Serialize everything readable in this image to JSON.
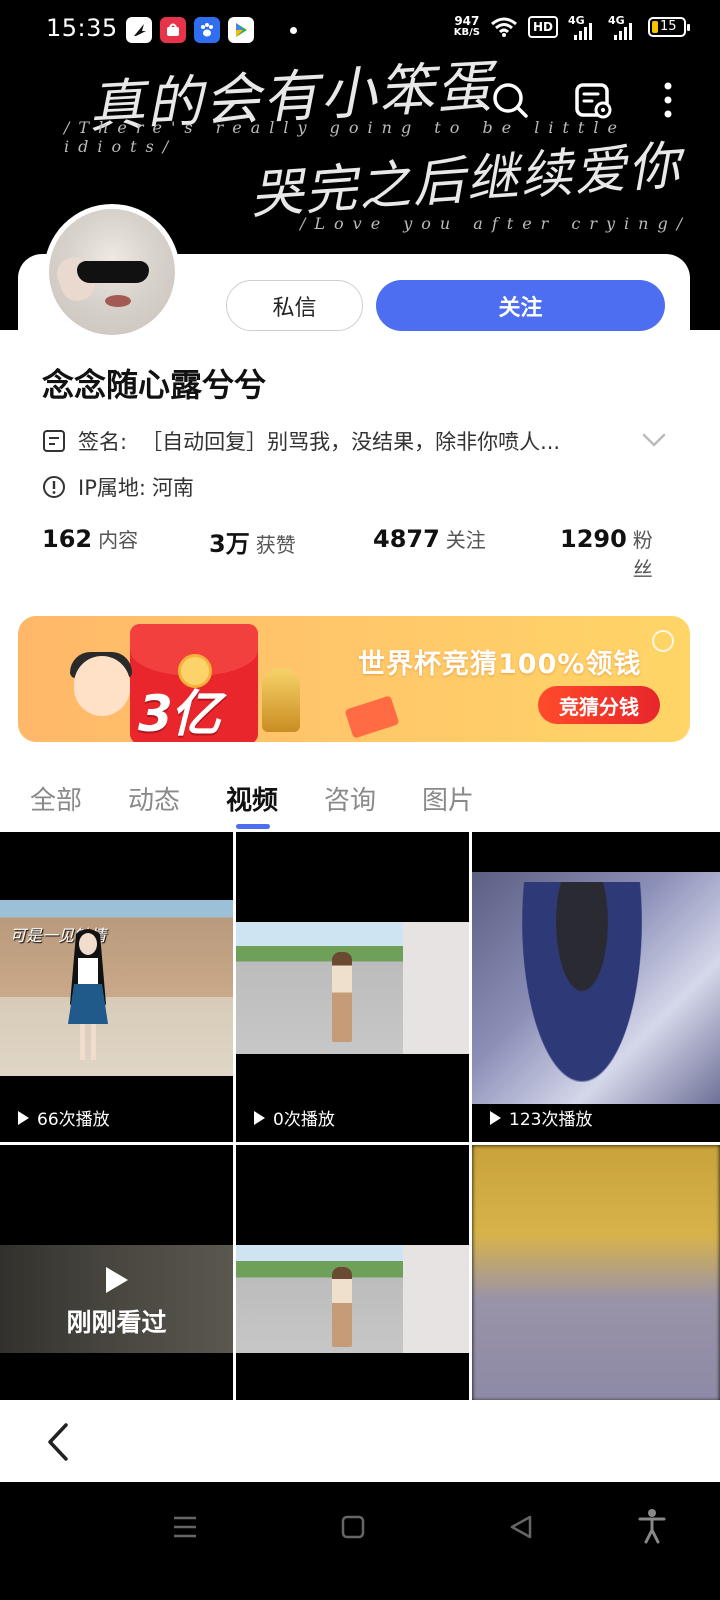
{
  "status_bar": {
    "time": "15:35",
    "net_speed_value": "947",
    "net_speed_unit": "KB/S",
    "hd_badge": "HD",
    "sim1": "4G",
    "sim2": "4G",
    "battery": "15",
    "battery_color": "#f5c400"
  },
  "cover": {
    "line1": "真的会有小笨蛋",
    "line1_en": "/There's really going to be little idiots/",
    "line2": "哭完之后继续爱你",
    "line2_en": "/Love you after crying/"
  },
  "header_icons": [
    "search-icon",
    "profile-card-icon",
    "more-vertical-icon"
  ],
  "profile": {
    "username": "念念随心露兮兮",
    "message_button": "私信",
    "follow_button": "关注",
    "sign_label": "签名:",
    "sign_text": "［自动回复］别骂我，没结果，除非你喷人...",
    "ip_label": "IP属地:",
    "ip_value": "河南",
    "accent_color": "#4e6ef2"
  },
  "stats": [
    {
      "value": "162",
      "label": "内容"
    },
    {
      "value": "3万",
      "label": "获赞"
    },
    {
      "value": "4877",
      "label": "关注"
    },
    {
      "value": "1290",
      "label": "粉丝"
    }
  ],
  "banner": {
    "amount": "3亿",
    "title": "世界杯竞猜100%领钱",
    "button": "竞猜分钱"
  },
  "tabs": [
    {
      "label": "全部"
    },
    {
      "label": "动态"
    },
    {
      "label": "视频",
      "active": true
    },
    {
      "label": "咨询"
    },
    {
      "label": "图片"
    }
  ],
  "videos": [
    {
      "plays": "66次播放",
      "caption": "可是一见钟情"
    },
    {
      "plays": "0次播放"
    },
    {
      "plays": "123次播放"
    },
    {
      "overlay": "刚刚看过"
    },
    {},
    {}
  ]
}
